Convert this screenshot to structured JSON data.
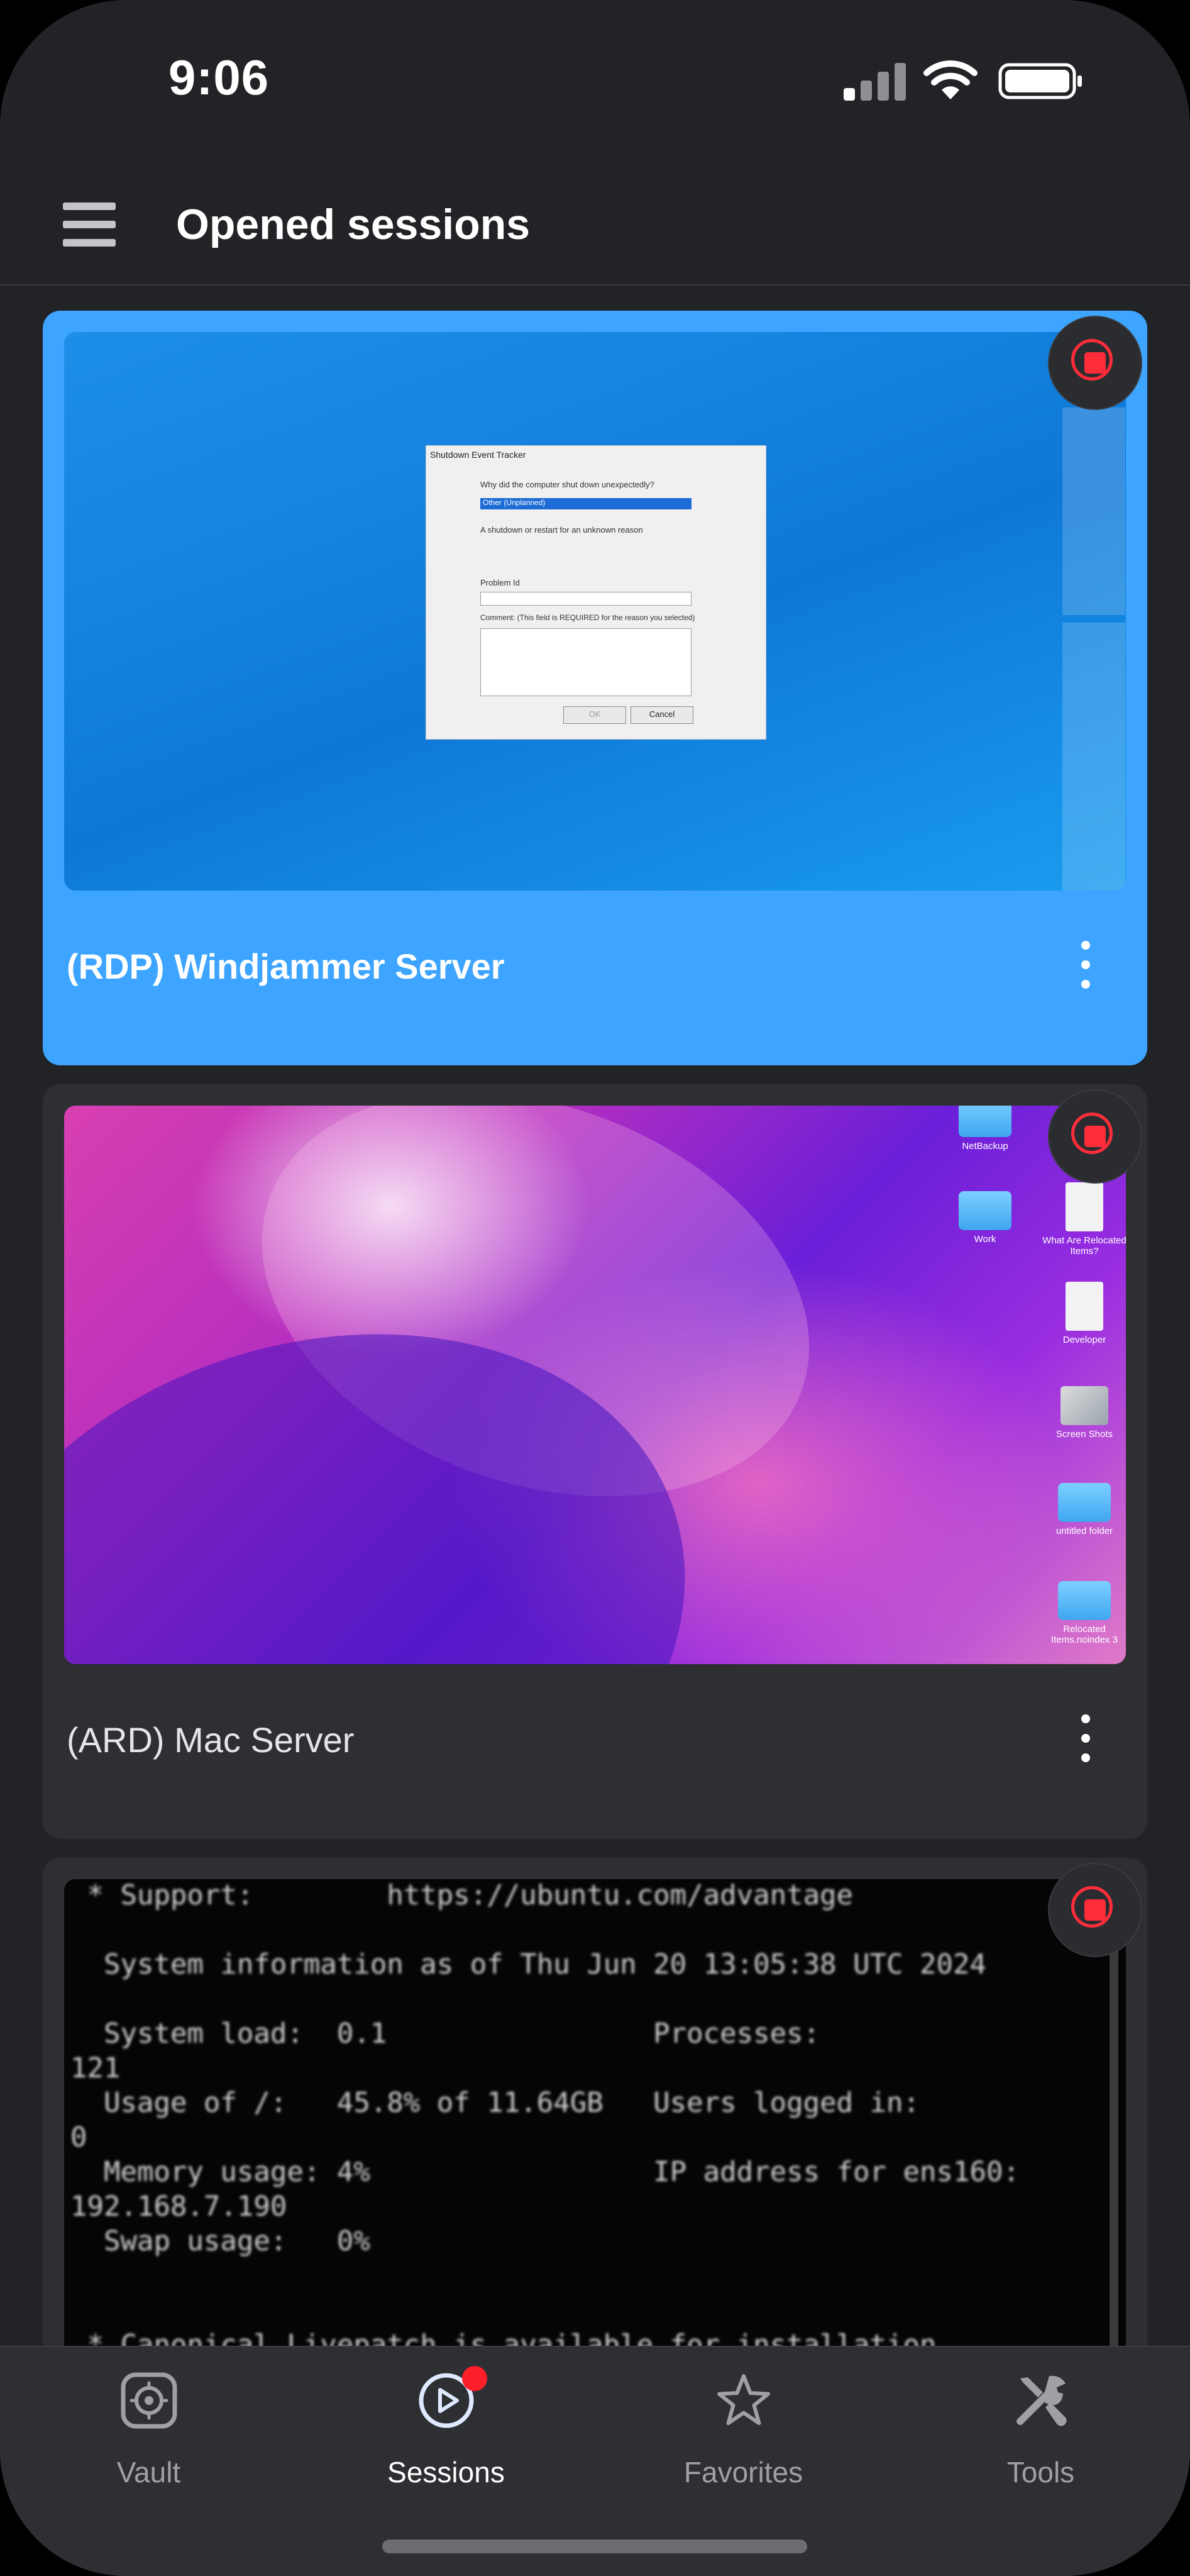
{
  "status_bar": {
    "time": "9:06"
  },
  "header": {
    "title": "Opened sessions"
  },
  "sessions": [
    {
      "label": "(RDP) Windjammer Server",
      "active": true
    },
    {
      "label": "(ARD) Mac Server",
      "active": false
    },
    {
      "label": "",
      "active": false
    }
  ],
  "rdp_dialog": {
    "title": "Shutdown Event Tracker",
    "question": "Why did the computer shut down unexpectedly?",
    "selected_option": "Other (Unplanned)",
    "description": "A shutdown or restart for an unknown reason",
    "problem_id_label": "Problem Id",
    "comment_label": "Comment: (This field is REQUIRED for the reason you selected)",
    "ok_label": "OK",
    "cancel_label": "Cancel"
  },
  "mac_desktop_icons": [
    {
      "label": "NetBackup"
    },
    {
      "label": "Work"
    },
    {
      "label": "What Are Relocated Items?"
    },
    {
      "label": "Developer"
    },
    {
      "label": "Screen Shots"
    },
    {
      "label": "untitled folder"
    },
    {
      "label": "Relocated Items.noindex 3"
    }
  ],
  "terminal_lines": [
    " * Support:        https://ubuntu.com/advantage",
    "",
    "  System information as of Thu Jun 20 13:05:38 UTC 2024",
    "",
    "  System load:  0.1                Processes:",
    "121",
    "  Usage of /:   45.8% of 11.64GB   Users logged in:",
    "0",
    "  Memory usage: 4%                 IP address for ens160:",
    "192.168.7.190",
    "  Swap usage:   0%",
    "",
    "",
    " * Canonical Livepatch is available for installation."
  ],
  "tabs": [
    {
      "label": "Vault",
      "icon": "vault-icon",
      "active": false
    },
    {
      "label": "Sessions",
      "icon": "sessions-icon",
      "active": true
    },
    {
      "label": "Favorites",
      "icon": "star-icon",
      "active": false
    },
    {
      "label": "Tools",
      "icon": "tools-icon",
      "active": false
    }
  ],
  "colors": {
    "background": "#222326",
    "active_card": "#3da4ff",
    "card": "#2e2f33",
    "stop_red": "#ff2d3a",
    "badge_red": "#ff1f2a"
  }
}
